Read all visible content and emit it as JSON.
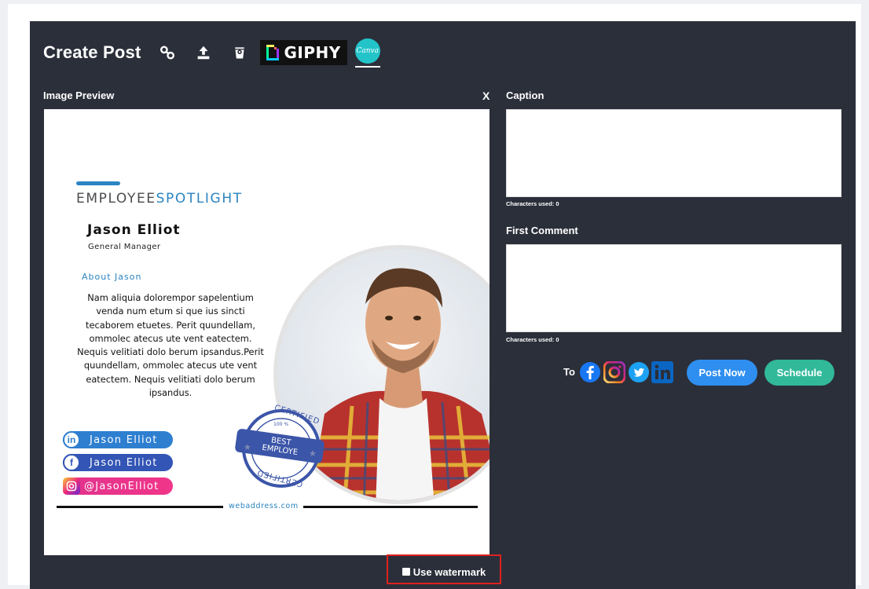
{
  "header": {
    "title": "Create Post",
    "tools": [
      {
        "icon": "link-icon"
      },
      {
        "icon": "upload-icon"
      },
      {
        "icon": "dropbox-icon"
      }
    ],
    "giphy_label": "GIPHY",
    "canva_label": "Canva"
  },
  "preview": {
    "label": "Image Preview",
    "close_label": "X",
    "image": {
      "heading_left": "EMPLOYEE",
      "heading_right": "SPOTLIGHT",
      "name": "Jason Elliot",
      "role": "General Manager",
      "about_heading": "About Jason",
      "about_body": "Nam aliquia dolorempor sapelentium venda num etum si que ius sincti tecaborem etuetes. Perit quundellam, ommolec atecus ute vent eatectem. Nequis velitiati dolo berum ipsandus.Perit quundellam, ommolec atecus ute vent eatectem. Nequis velitiati dolo berum ipsandus.",
      "socials": [
        {
          "network": "linkedin",
          "handle": "Jason Elliot",
          "color": "#2e7fd0"
        },
        {
          "network": "facebook",
          "handle": "Jason Elliot",
          "color": "#3355b5"
        },
        {
          "network": "instagram",
          "handle": "@JasonElliot",
          "color": "#e2338c"
        }
      ],
      "badge": {
        "top": "CERTIFIED",
        "line1": "BEST",
        "line2": "EMPLOYE",
        "bottom": "CERTIFIED",
        "small": "100 %"
      },
      "web": "webaddress.com"
    },
    "watermark_label": "Use watermark",
    "watermark_checked": false
  },
  "caption": {
    "label": "Caption",
    "value": "",
    "count_label": "Characters used: 0"
  },
  "first_comment": {
    "label": "First Comment",
    "value": "",
    "count_label": "Characters used: 0"
  },
  "publish": {
    "to_label": "To",
    "networks": [
      {
        "name": "facebook",
        "color": "#1877f2"
      },
      {
        "name": "instagram",
        "color": "#d62976"
      },
      {
        "name": "twitter",
        "color": "#1da1f2"
      },
      {
        "name": "linkedin",
        "color": "#0a66c2"
      }
    ],
    "post_now_label": "Post Now",
    "post_now_color": "#2f8ff0",
    "schedule_label": "Schedule",
    "schedule_color": "#31b99a"
  }
}
